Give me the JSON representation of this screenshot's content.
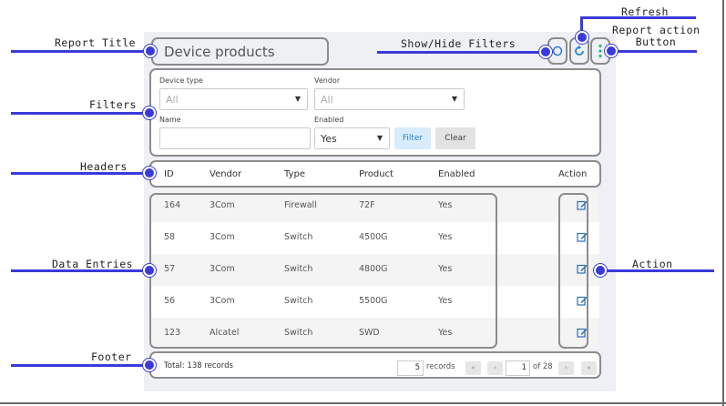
{
  "report": {
    "title": "Device products"
  },
  "filters": {
    "device_type": {
      "label": "Device type",
      "value": "All"
    },
    "vendor": {
      "label": "Vendor",
      "value": "All"
    },
    "name": {
      "label": "Name",
      "value": ""
    },
    "enabled": {
      "label": "Enabled",
      "value": "Yes"
    },
    "filter_button": "Filter",
    "clear_button": "Clear"
  },
  "table": {
    "headers": [
      "ID",
      "Vendor",
      "Type",
      "Product",
      "Enabled",
      "Action"
    ],
    "rows": [
      [
        "164",
        "3Com",
        "Firewall",
        "72F",
        "Yes"
      ],
      [
        "58",
        "3Com",
        "Switch",
        "4500G",
        "Yes"
      ],
      [
        "57",
        "3Com",
        "Switch",
        "4800G",
        "Yes"
      ],
      [
        "56",
        "3Com",
        "Switch",
        "5500G",
        "Yes"
      ],
      [
        "123",
        "Alcatel",
        "Switch",
        "SWD",
        "Yes"
      ]
    ]
  },
  "footer": {
    "total": "Total: 138 records",
    "page_size": "5",
    "records_label": "records",
    "first": "«",
    "prev": "‹",
    "page": "1",
    "of_pages": "of 28",
    "next": "›",
    "last": "»"
  },
  "annotations": {
    "report_title": "Report Title",
    "filters": "Filters",
    "headers": "Headers",
    "data_entries": "Data Entries",
    "footer": "Footer",
    "show_hide_filters": "Show/Hide Filters",
    "refresh": "Refresh",
    "report_action_line1": "Report action",
    "report_action_line2": "Button",
    "action": "Action"
  },
  "colors": {
    "callout": "#3a3adb",
    "refresh_icon": "#2a7fc7",
    "action_dots": "#2bb673",
    "edit_icon": "#2a6fb0"
  },
  "icons": {
    "filters_toggle": "circle-outline-icon",
    "refresh": "refresh-icon",
    "report_action": "vertical-dots-icon",
    "row_action": "edit-icon"
  }
}
